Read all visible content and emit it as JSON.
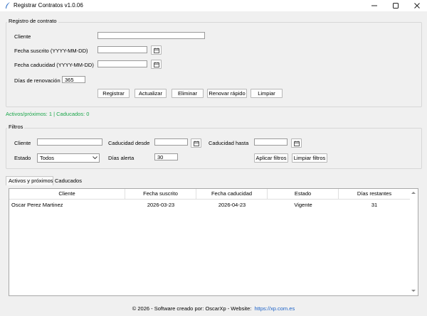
{
  "window": {
    "title": "Registrar Contratos v1.0.06"
  },
  "form": {
    "legend": "Registro de contrato",
    "cliente_label": "Cliente",
    "cliente_value": "",
    "fecha_suscrito_label": "Fecha suscrito (YYYY-MM-DD)",
    "fecha_suscrito_value": "",
    "fecha_caducidad_label": "Fecha caducidad (YYYY-MM-DD)",
    "fecha_caducidad_value": "",
    "dias_renovacion_label": "Días de renovación",
    "dias_renovacion_value": "365",
    "buttons": {
      "registrar": "Registrar",
      "actualizar": "Actualizar",
      "eliminar": "Eliminar",
      "renovar": "Renovar rápido",
      "limpiar": "Limpiar"
    }
  },
  "status": {
    "text": "Activos/próximos: 1 | Caducados: 0",
    "color": "#1aa64a"
  },
  "filters": {
    "legend": "Filtros",
    "cliente_label": "Cliente",
    "cliente_value": "",
    "caducidad_desde_label": "Caducidad desde",
    "caducidad_desde_value": "",
    "caducidad_hasta_label": "Caducidad hasta",
    "caducidad_hasta_value": "",
    "estado_label": "Estado",
    "estado_value": "Todos",
    "dias_alerta_label": "Días alerta",
    "dias_alerta_value": "30",
    "aplicar_label": "Aplicar filtros",
    "limpiar_label": "Limpiar filtros"
  },
  "tabs": [
    {
      "label": "Activos y próximos",
      "active": true
    },
    {
      "label": "Caducados",
      "active": false
    }
  ],
  "table": {
    "columns": [
      "Cliente",
      "Fecha suscrito",
      "Fecha caducidad",
      "Estado",
      "Días restantes"
    ],
    "rows": [
      [
        "Oscar Perez Martinez",
        "2026-03-23",
        "2026-04-23",
        "Vigente",
        "31"
      ]
    ]
  },
  "footer": {
    "text": "©  2026 - Software creado por: OscarXp - Website:",
    "link": "https://xp.com.es",
    "link_color": "#1e63c8"
  },
  "icons": {
    "app": "feather-icon",
    "minimize": "minimize-icon",
    "maximize": "maximize-icon",
    "close": "close-icon",
    "calendar": "calendar-icon",
    "dropdown": "chevron-down-icon"
  }
}
